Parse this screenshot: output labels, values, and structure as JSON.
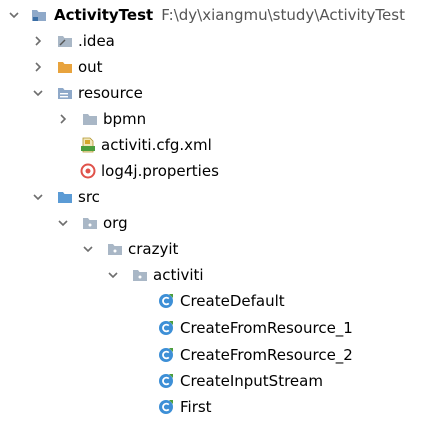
{
  "project": {
    "name": "ActivityTest",
    "path": "F:\\dy\\xiangmu\\study\\ActivityTest"
  },
  "tree": {
    "idea": ".idea",
    "out": "out",
    "resource": "resource",
    "bpmn": "bpmn",
    "activiti_cfg": "activiti.cfg.xml",
    "log4j": "log4j.properties",
    "src": "src",
    "org": "org",
    "crazyit": "crazyit",
    "activiti": "activiti",
    "classes": [
      "CreateDefault",
      "CreateFromResource_1",
      "CreateFromResource_2",
      "CreateInputStream",
      "First"
    ]
  },
  "colors": {
    "folder": "#8fa9c9",
    "folder_out": "#e8a33d",
    "class_icon": "#3d8fd6",
    "xml_icon": "#d4a72c",
    "props_icon": "#e0524a",
    "arrow": "#6e6e6e"
  }
}
